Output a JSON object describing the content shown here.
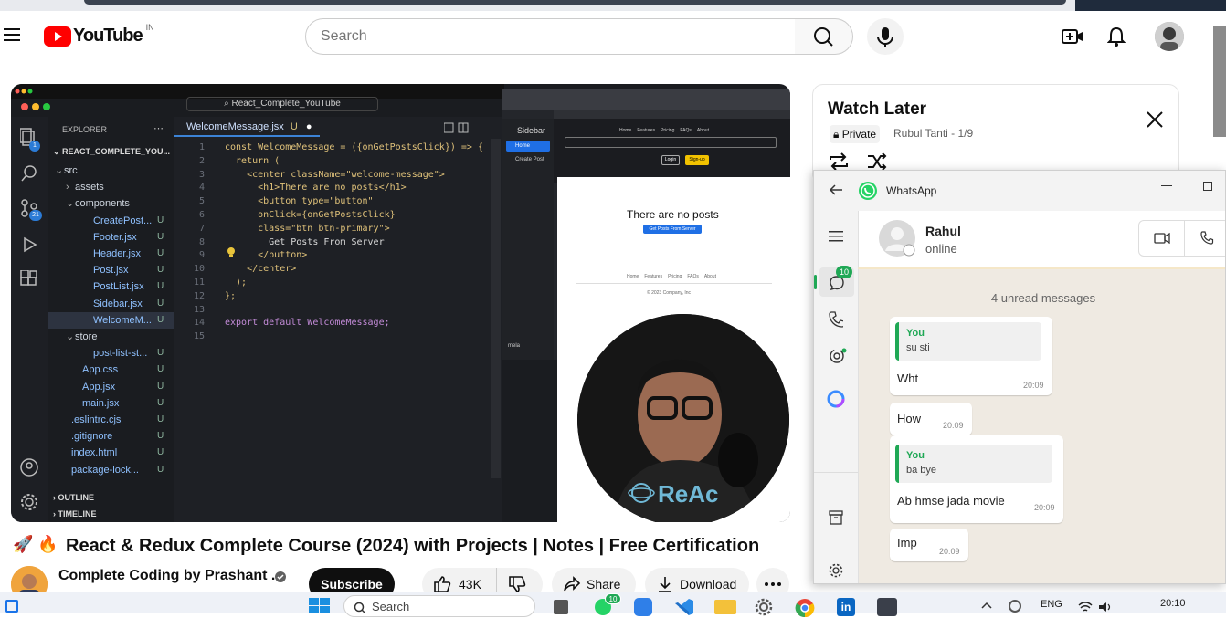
{
  "youtube": {
    "logo_text": "YouTube",
    "region": "IN",
    "search_placeholder": "Search"
  },
  "video": {
    "editor": {
      "explorer_label": "EXPLORER",
      "project": "REACT_COMPLETE_YOU...",
      "tab": "WelcomeMessage.jsx",
      "tab_status": "U",
      "search_bar": "React_Complete_YouTube",
      "badges": {
        "files": "1",
        "git": "21"
      },
      "tree": [
        {
          "name": "src",
          "status": ""
        },
        {
          "name": "assets",
          "status": ""
        },
        {
          "name": "components",
          "status": ""
        },
        {
          "name": "CreatePost...",
          "status": "U"
        },
        {
          "name": "Footer.jsx",
          "status": "U"
        },
        {
          "name": "Header.jsx",
          "status": "U"
        },
        {
          "name": "Post.jsx",
          "status": "U"
        },
        {
          "name": "PostList.jsx",
          "status": "U"
        },
        {
          "name": "Sidebar.jsx",
          "status": "U"
        },
        {
          "name": "WelcomeM...",
          "status": "U"
        },
        {
          "name": "store",
          "status": ""
        },
        {
          "name": "post-list-st...",
          "status": "U"
        },
        {
          "name": "App.css",
          "status": "U"
        },
        {
          "name": "App.jsx",
          "status": "U"
        },
        {
          "name": "main.jsx",
          "status": "U"
        },
        {
          "name": ".eslintrc.cjs",
          "status": "U"
        },
        {
          "name": ".gitignore",
          "status": "U"
        },
        {
          "name": "index.html",
          "status": "U"
        },
        {
          "name": "package-lock...",
          "status": "U"
        }
      ],
      "outline": "OUTLINE",
      "timeline": "TIMELINE",
      "code": [
        "const WelcomeMessage = ({onGetPostsClick}) => {",
        "  return (",
        "    <center className=\"welcome-message\">",
        "      <h1>There are no posts</h1>",
        "      <button type=\"button\"",
        "      onClick={onGetPostsClick}",
        "      class=\"btn btn-primary\">",
        "        Get Posts From Server",
        "      </button>",
        "    </center>",
        "  );",
        "};",
        "",
        "export default WelcomeMessage;",
        ""
      ]
    },
    "preview": {
      "sidebar_title": "Sidebar",
      "home": "Home",
      "create_post": "Create Post",
      "nav": [
        "Home",
        "Features",
        "Pricing",
        "FAQs",
        "About"
      ],
      "login": "Login",
      "signup": "Sign-up",
      "heading": "There are no posts",
      "button": "Get Posts From Server",
      "footer_nav": [
        "Home",
        "Features",
        "Pricing",
        "FAQs",
        "About"
      ],
      "copyright": "© 2023 Company, Inc",
      "user": "mela"
    },
    "shirt_text": "ReAc"
  },
  "watch_later": {
    "title": "Watch Later",
    "privacy": "Private",
    "meta": "Rubul Tanti - 1/9"
  },
  "whatsapp": {
    "app_name": "WhatsApp",
    "contact_name": "Rahul",
    "contact_status": "online",
    "chats_badge": "10",
    "unread": "4 unread messages",
    "messages": [
      {
        "quote_author": "You",
        "quote_text": "su sti",
        "text": "Wht",
        "time": "20:09"
      },
      {
        "quote_author": "",
        "quote_text": "",
        "text": "How",
        "time": "20:09"
      },
      {
        "quote_author": "You",
        "quote_text": "ba bye",
        "text": "Ab hmse jada movie",
        "time": "20:09"
      },
      {
        "quote_author": "",
        "quote_text": "",
        "text": "Imp",
        "time": "20:09"
      }
    ]
  },
  "watch": {
    "emojis": "🚀 🔥",
    "title": "React & Redux Complete Course (2024) with Projects | Notes | Free Certification",
    "channel": "Complete Coding by Prashant ...",
    "subscribe": "Subscribe",
    "likes": "43K",
    "share": "Share",
    "download": "Download"
  },
  "taskbar": {
    "search": "Search",
    "lang": "ENG",
    "time": "20:10",
    "whatsapp_badge": "10"
  },
  "colors": {
    "youtube_red": "#ff0000",
    "whatsapp_green": "#1fa855",
    "editor_bg": "#1a1c20"
  }
}
